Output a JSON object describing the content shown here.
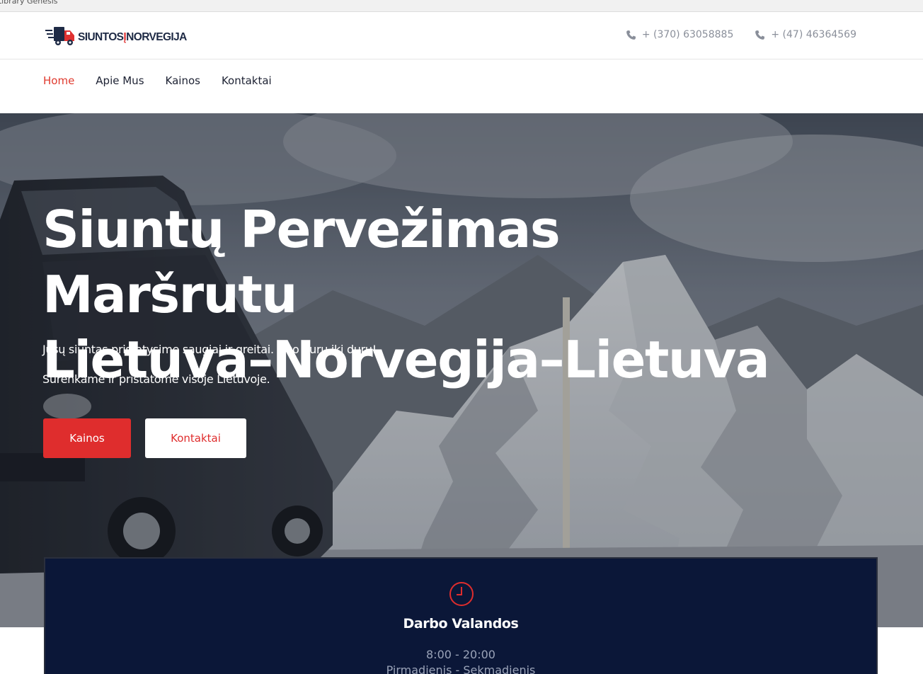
{
  "browser": {
    "tab_title": "Library Genesis"
  },
  "header": {
    "logo_text_left": "SIUNTOS",
    "logo_text_i": "Į",
    "logo_text_right": "NORVEGIJA",
    "phones": [
      {
        "number": "+ (370) 63058885",
        "icon": "phone-icon"
      },
      {
        "number": "+ (47) 46364569",
        "icon": "phone-icon"
      }
    ]
  },
  "nav": {
    "items": [
      {
        "label": "Home",
        "active": true
      },
      {
        "label": "Apie Mus",
        "active": false
      },
      {
        "label": "Kainos",
        "active": false
      },
      {
        "label": "Kontaktai",
        "active": false
      }
    ]
  },
  "hero": {
    "title_line1": "Siuntų Pervežimas Maršrutu",
    "title_line2": "Lietuva–Norvegija–Lietuva",
    "subtitle1": "Jūsų siuntas pristatysime saugiai ir greitai. Nuo durų iki durų!",
    "subtitle2": "Surenkame ir pristatome visoje Lietuvoje.",
    "primary_button": "Kainos",
    "secondary_button": "Kontaktai"
  },
  "hours_card": {
    "icon": "clock-icon",
    "title": "Darbo Valandos",
    "hours": "8:00 - 20:00",
    "days": "Pirmadienis - Sekmadienis"
  },
  "colors": {
    "accent": "#df2d2d",
    "nav_text": "#1d2233",
    "card_bg": "#0b1738",
    "muted_text": "#8a8f9a"
  }
}
